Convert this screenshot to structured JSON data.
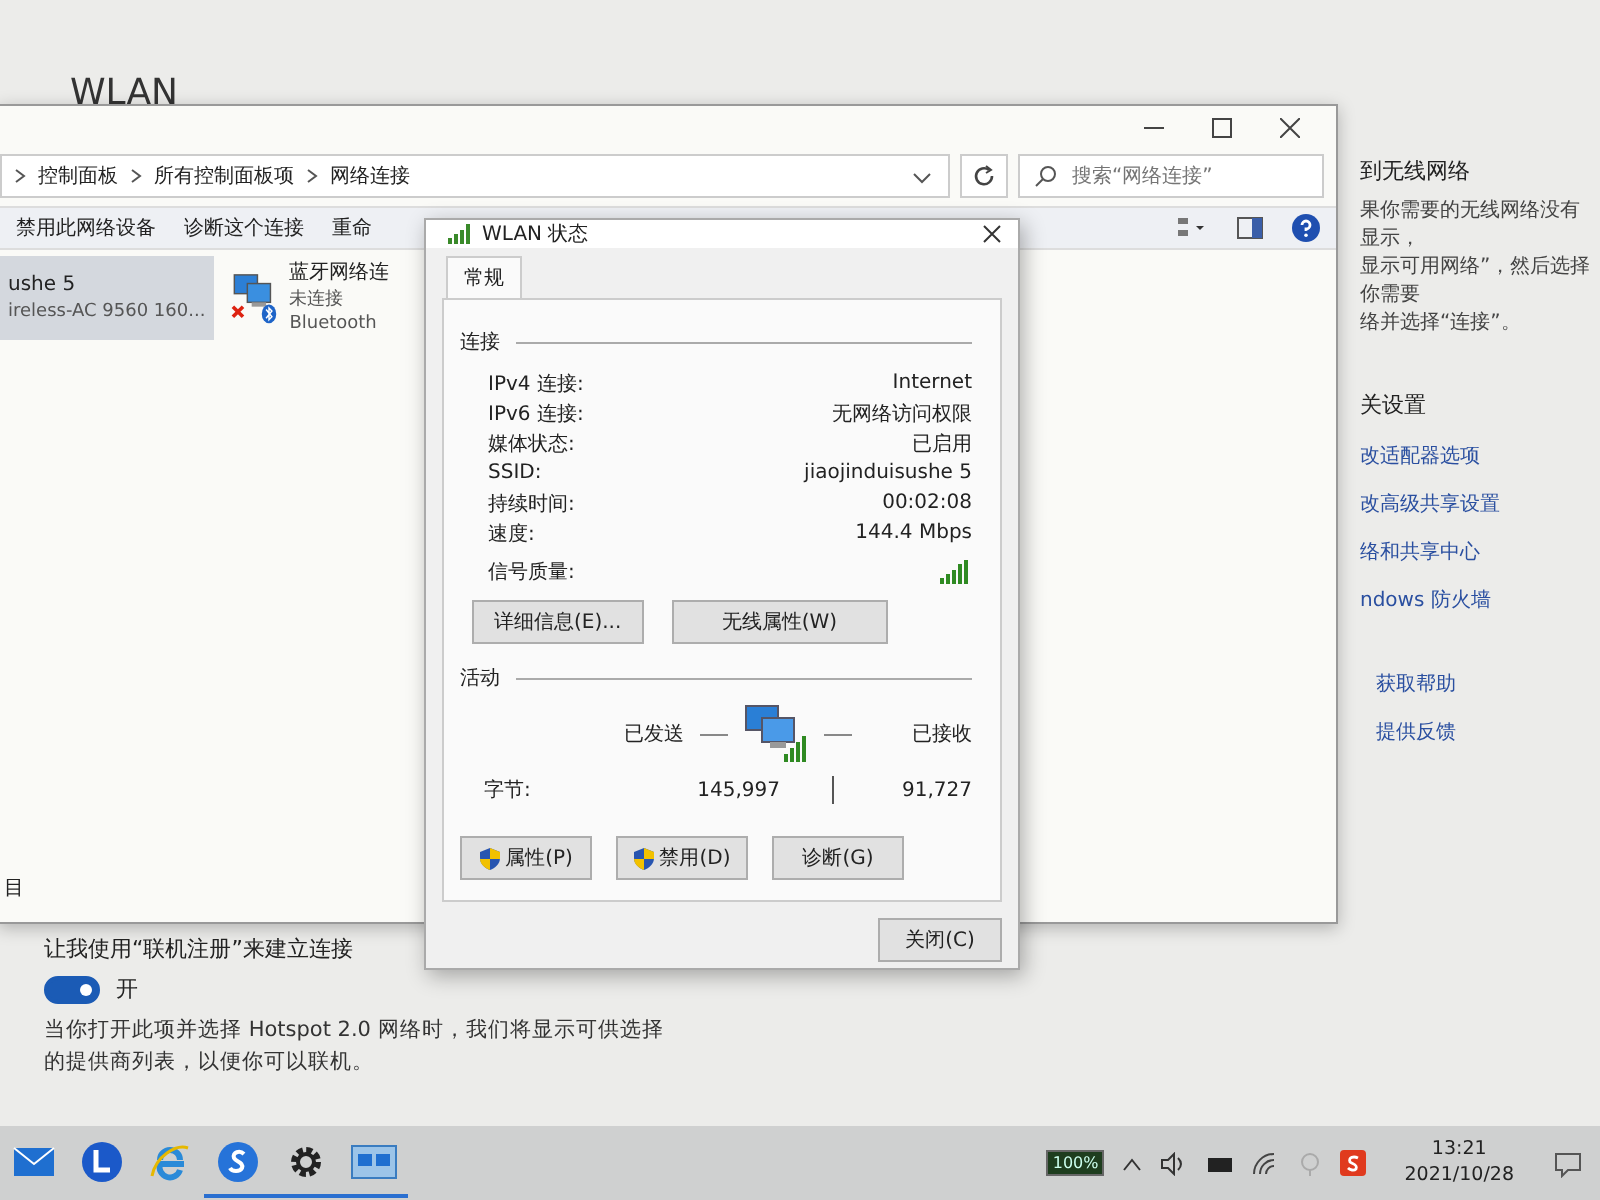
{
  "settings": {
    "title": "WLAN",
    "help_title": "到无线网络",
    "help_lines": [
      "果你需要的无线网络没有显示，",
      "显示可用网络”，然后选择你需要",
      "络并选择“连接”。"
    ],
    "related_title": "关设置",
    "related_links": [
      "改适配器选项",
      "改高级共享设置",
      "络和共享中心",
      "ndows 防火墙"
    ],
    "support_links": [
      "获取帮助",
      "提供反馈"
    ],
    "hotspot_label": "让我使用“联机注册”来建立连接",
    "hotspot_toggle": {
      "on": true,
      "label": "开"
    },
    "hotspot_description": "当你打开此项并选择 Hotspot 2.0 网络时，我们将显示可供选择的提供商列表，以便你可以联机。"
  },
  "explorer": {
    "breadcrumb": [
      "控制面板",
      "所有控制面板项",
      "网络连接"
    ],
    "search": {
      "placeholder": "搜索“网络连接”"
    },
    "toolbar": [
      "禁用此网络设备",
      "诊断这个连接",
      "重命"
    ],
    "items": [
      {
        "name": "ushe 5",
        "lines": [
          "ireless-AC 9560 160..."
        ],
        "selected": true,
        "show_icon": false
      },
      {
        "name": "蓝牙网络连",
        "lines": [
          "未连接",
          "Bluetooth"
        ],
        "selected": false,
        "disconnected": true,
        "show_icon": true
      }
    ],
    "status_bar": "目"
  },
  "dialog": {
    "title": "WLAN 状态",
    "tabs": [
      {
        "label": "常规",
        "selected": true
      }
    ],
    "connection_heading": "连接",
    "rows": [
      {
        "label": "IPv4 连接:",
        "value": "Internet"
      },
      {
        "label": "IPv6 连接:",
        "value": "无网络访问权限"
      },
      {
        "label": "媒体状态:",
        "value": "已启用"
      },
      {
        "label": "SSID:",
        "value": "jiaojinduisushe 5"
      },
      {
        "label": "持续时间:",
        "value": "00:02:08"
      },
      {
        "label": "速度:",
        "value": "144.4 Mbps"
      }
    ],
    "signal_label": "信号质量:",
    "connection_buttons": [
      "详细信息(E)...",
      "无线属性(W)"
    ],
    "activity_heading": "活动",
    "sent_label": "已发送",
    "received_label": "已接收",
    "bytes_label": "字节:",
    "bytes_sent": "145,997",
    "bytes_received": "91,727",
    "action_buttons": [
      {
        "label": "属性(P)",
        "shield": true
      },
      {
        "label": "禁用(D)",
        "shield": true
      },
      {
        "label": "诊断(G)",
        "shield": false
      }
    ],
    "close_button": "关闭(C)"
  },
  "taskbar": {
    "apps": [
      {
        "kind": "mail",
        "running": false
      },
      {
        "kind": "letter",
        "running": false
      },
      {
        "kind": "browser",
        "running": false
      },
      {
        "kind": "s",
        "running": true
      },
      {
        "kind": "gear",
        "running": true
      },
      {
        "kind": "network",
        "running": true
      }
    ],
    "battery": "100%",
    "time": "13:21",
    "date": "2021/10/28"
  }
}
